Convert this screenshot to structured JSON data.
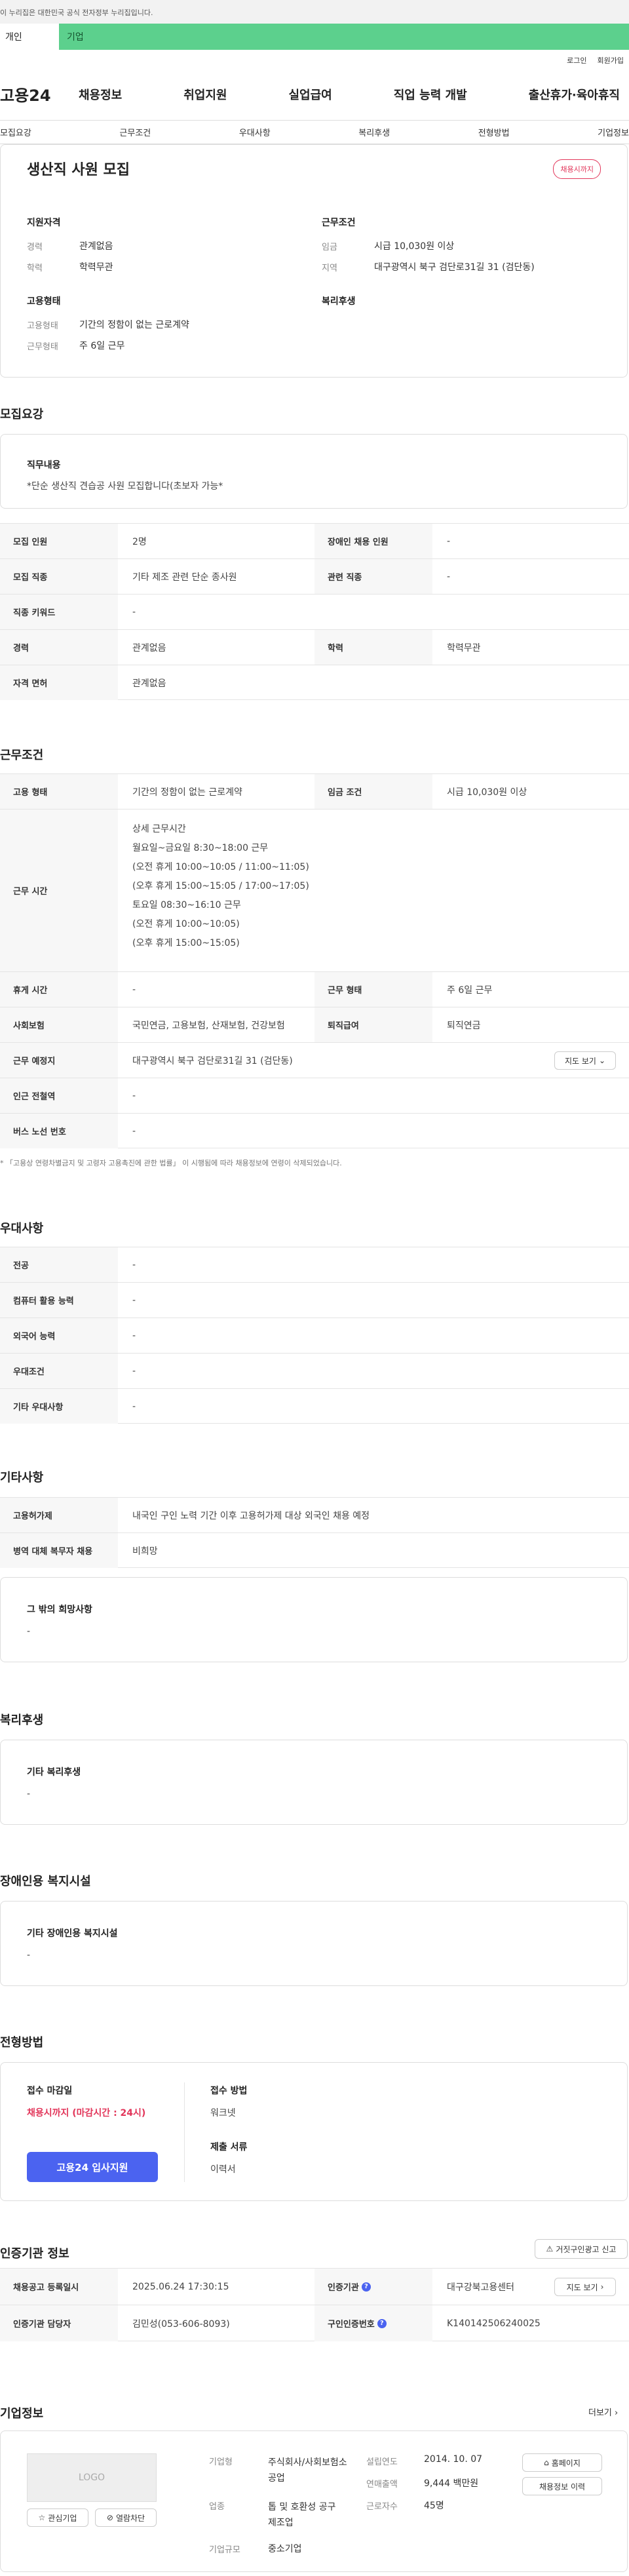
{
  "gov_banner": "이 누리집은 대한민국 공식 전자정부 누리집입니다.",
  "site_tabs": [
    "개인",
    "기업"
  ],
  "util": [
    "로그인",
    "회원가입"
  ],
  "logo": "고용24",
  "gnb": [
    "채용정보",
    "취업지원",
    "실업급여",
    "직업 능력 개발",
    "출산휴가·육아휴직"
  ],
  "subnav": [
    "모집요강",
    "근무조건",
    "우대사항",
    "복리후생",
    "전형방법",
    "기업정보"
  ],
  "job": {
    "title": "생산직 사원 모집",
    "deadline_badge": "채용시까지",
    "qual_h": "지원자격",
    "career_l": "경력",
    "career_v": "관계없음",
    "edu_l": "학력",
    "edu_v": "학력무관",
    "emp_h": "고용형태",
    "emptype_l": "고용형태",
    "emptype_v": "기간의 정함이 없는 근로계약",
    "workform_l": "근무형태",
    "workform_v": "주 6일 근무",
    "cond_h": "근무조건",
    "wage_l": "임금",
    "wage_v": "시급 10,030원 이상",
    "region_l": "지역",
    "region_v": "대구광역시 북구 검단로31길 31 (검단동)",
    "welfare_h": "복리후생"
  },
  "recruit": {
    "h": "모집요강",
    "duty_t": "직무내용",
    "duty_v": "*단순 생산직 견습공 사원 모집합니다(초보자 가능*",
    "r1": [
      "모집 인원",
      "2명",
      "장애인 채용 인원",
      "-"
    ],
    "r2": [
      "모집 직종",
      "기타 제조 관련 단순 종사원",
      "관련 직종",
      "-"
    ],
    "r3": [
      "직종 키워드",
      "-"
    ],
    "r4": [
      "경력",
      "관계없음",
      "학력",
      "학력무관"
    ],
    "r5": [
      "자격 면허",
      "관계없음"
    ]
  },
  "work": {
    "h": "근무조건",
    "r1": [
      "고용 형태",
      "기간의 정함이 없는 근로계약",
      "임금 조건",
      "시급 10,030원 이상"
    ],
    "time_l": "근무 시간",
    "time_t": "상세 근무시간",
    "time_lines": [
      "월요일~금요일 8:30~18:00 근무",
      "(오전 휴게 10:00~10:05 / 11:00~11:05)",
      "(오후 휴게 15:00~15:05 / 17:00~17:05)",
      "토요일 08:30~16:10 근무",
      "(오전 휴게 10:00~10:05)",
      "(오후 휴게 15:00~15:05)"
    ],
    "r3": [
      "휴게 시간",
      "-",
      "근무 형태",
      "주 6일 근무"
    ],
    "r4": [
      "사회보험",
      "국민연금, 고용보험, 산재보험, 건강보험",
      "퇴직급여",
      "퇴직연금"
    ],
    "r5": [
      "근무 예정지",
      "대구광역시 북구 검단로31길 31 (검단동)"
    ],
    "map_btn": "지도 보기",
    "r6": [
      "인근 전철역",
      "-"
    ],
    "r7": [
      "버스 노선 번호",
      "-"
    ],
    "note": "* 「고용상 연령차별금지 및 고령자 고용촉진에 관한 법률」 이 시행됨에 따라 채용정보에 연령이 삭제되었습니다."
  },
  "pref": {
    "h": "우대사항",
    "rows": [
      [
        "전공",
        "-"
      ],
      [
        "컴퓨터 활용 능력",
        "-"
      ],
      [
        "외국어 능력",
        "-"
      ],
      [
        "우대조건",
        "-"
      ],
      [
        "기타 우대사항",
        "-"
      ]
    ]
  },
  "etc": {
    "h": "기타사항",
    "r1": [
      "고용허가제",
      "내국인 구인 노력 기간 이후 고용허가제 대상 외국인 채용 예정"
    ],
    "r2": [
      "병역 대체 복무자 채용",
      "비희망"
    ],
    "other_t": "그 밖의 희망사항",
    "other_v": "-"
  },
  "welfare": {
    "h": "복리후생",
    "t": "기타 복리후생",
    "v": "-"
  },
  "disab": {
    "h": "장애인용 복지시설",
    "t": "기타 장애인용 복지시설",
    "v": "-"
  },
  "select": {
    "h": "전형방법",
    "deadline_t": "접수 마감일",
    "deadline_v": "채용시까지 (마감시간 : 24시)",
    "apply_btn": "고용24 입사지원",
    "method_t": "접수 방법",
    "method_v": "워크넷",
    "docs_t": "제출 서류",
    "docs_v": "이력서"
  },
  "agency": {
    "h": "인증기관 정보",
    "report_btn": "거짓구인광고 신고",
    "r1": [
      "채용공고 등록일시",
      "2025.06.24 17:30:15",
      "인증기관",
      "대구강북고용센터"
    ],
    "map_btn": "지도 보기",
    "r2": [
      "인증기관 담당자",
      "김민성(053-606-8093)",
      "구인인증번호",
      "K140142506240025"
    ]
  },
  "company": {
    "h": "기업정보",
    "more": "더보기",
    "logo_text": "LOGO",
    "fav_btn": "관심기업",
    "block_btn": "열람차단",
    "type_l": "기업형",
    "type_v": [
      "주식회사/사회보험소",
      "공업"
    ],
    "ind_l": "업종",
    "ind_v": [
      "톱 및 호환성 공구",
      "제조업"
    ],
    "size_l": "기업규모",
    "size_v": "중소기업",
    "year_l": "설립연도",
    "year_v": "2014. 10. 07",
    "sales_l": "연매출액",
    "sales_v": "9,444 백만원",
    "emp_l": "근로자수",
    "emp_v": "45명",
    "home_btn": "홈페이지",
    "history_btn": "채용정보 이력"
  }
}
